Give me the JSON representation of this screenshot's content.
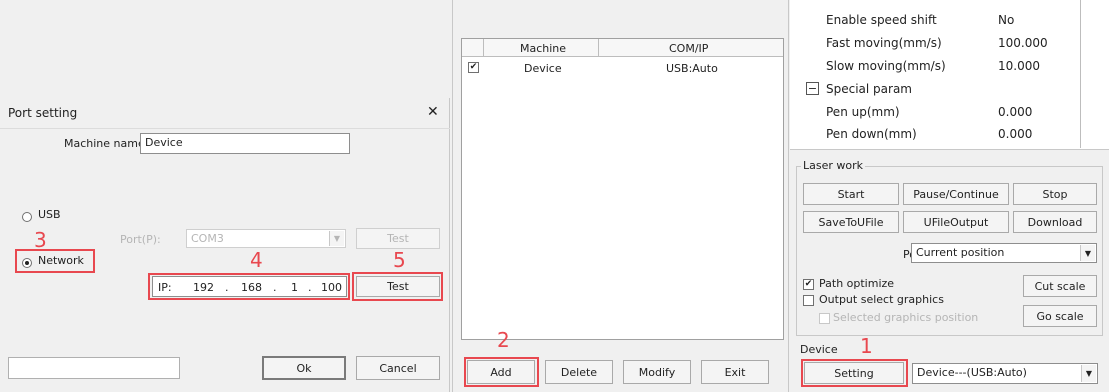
{
  "port_dialog": {
    "title": "Port setting",
    "close_glyph": "✕",
    "machine_name_label": "Machine name:",
    "machine_name_value": "Device",
    "usb_label": "USB",
    "port_label": "Port(P):",
    "port_value": "COM3",
    "usb_test_label": "Test",
    "network_label": "Network",
    "ip_label": "IP:",
    "ip_octets": [
      "192",
      "168",
      "1",
      "100"
    ],
    "ip_dot": ".",
    "test_label": "Test",
    "ok_label": "Ok",
    "cancel_label": "Cancel"
  },
  "device_list": {
    "columns": [
      "Machine",
      "COM/IP"
    ],
    "rows": [
      {
        "checked": "✔",
        "machine": "Device",
        "comip": "USB:Auto"
      }
    ],
    "add_label": "Add",
    "delete_label": "Delete",
    "modify_label": "Modify",
    "exit_label": "Exit"
  },
  "properties": {
    "rows": [
      {
        "name": "Enable speed shift",
        "value": "No"
      },
      {
        "name": "Fast moving(mm/s)",
        "value": "100.000"
      },
      {
        "name": "Slow moving(mm/s)",
        "value": "10.000"
      }
    ],
    "group_name": "Special param",
    "group_toggle": "−",
    "group_rows": [
      {
        "name": "Pen up(mm)",
        "value": "0.000"
      },
      {
        "name": "Pen down(mm)",
        "value": "0.000"
      }
    ]
  },
  "laser_work": {
    "title": "Laser work",
    "start_label": "Start",
    "pause_label": "Pause/Continue",
    "stop_label": "Stop",
    "save_label": "SaveToUFile",
    "ufile_label": "UFileOutput",
    "download_label": "Download",
    "position_label": "Position:",
    "position_value": "Current position",
    "path_optimize_label": "Path optimize",
    "output_select_label": "Output select graphics",
    "selected_graphics_label": "Selected graphics position",
    "cut_scale_label": "Cut scale",
    "go_scale_label": "Go scale"
  },
  "device_panel": {
    "title": "Device",
    "setting_label": "Setting",
    "device_value": "Device---(USB:Auto)"
  },
  "annotations": {
    "n1": "1",
    "n2": "2",
    "n3": "3",
    "n4": "4",
    "n5": "5",
    "color": "#e8484f"
  }
}
